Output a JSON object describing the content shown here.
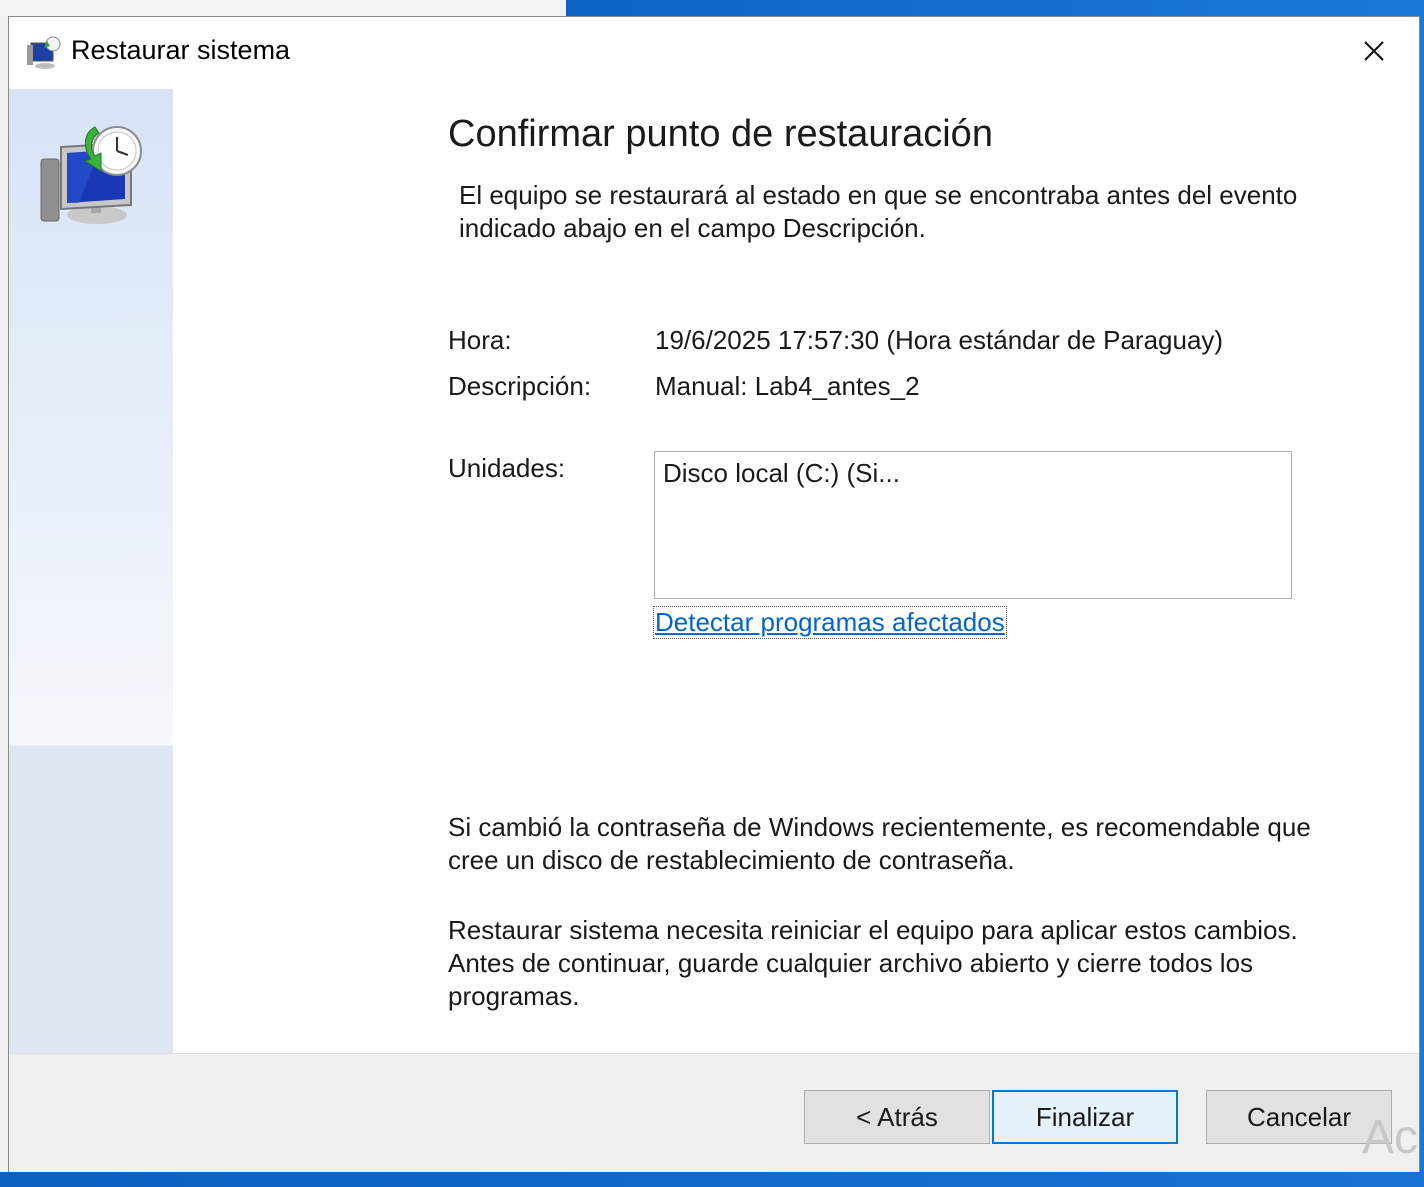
{
  "window": {
    "title": "Restaurar sistema",
    "close_glyph": "✕"
  },
  "page": {
    "heading": "Confirmar punto de restauración",
    "intro": "El equipo se restaurará al estado en que se encontraba antes del evento indicado abajo en el campo Descripción."
  },
  "fields": {
    "time_label": "Hora:",
    "time_value": "19/6/2025 17:57:30 (Hora estándar de Paraguay)",
    "description_label": "Descripción:",
    "description_value": "Manual: Lab4_antes_2",
    "drives_label": "Unidades:",
    "drives_items": [
      "Disco local (C:) (Si..."
    ]
  },
  "links": {
    "affected_programs": "Detectar programas afectados"
  },
  "notes": {
    "password_note": "Si cambió la contraseña de Windows recientemente, es recomendable que cree un disco de restablecimiento de contraseña.",
    "restart_note": "Restaurar sistema necesita reiniciar el equipo para aplicar estos cambios. Antes de continuar, guarde cualquier archivo abierto y cierre todos los programas."
  },
  "buttons": {
    "back": "< Atrás",
    "finish": "Finalizar",
    "cancel": "Cancelar"
  },
  "watermark": "Ac",
  "icons": {
    "title": "system-restore-icon",
    "side": "system-restore-large-icon",
    "close": "close-icon"
  },
  "colors": {
    "link": "#0066cc",
    "accent": "#0078d7",
    "side_panel": "#dfe7f5"
  }
}
